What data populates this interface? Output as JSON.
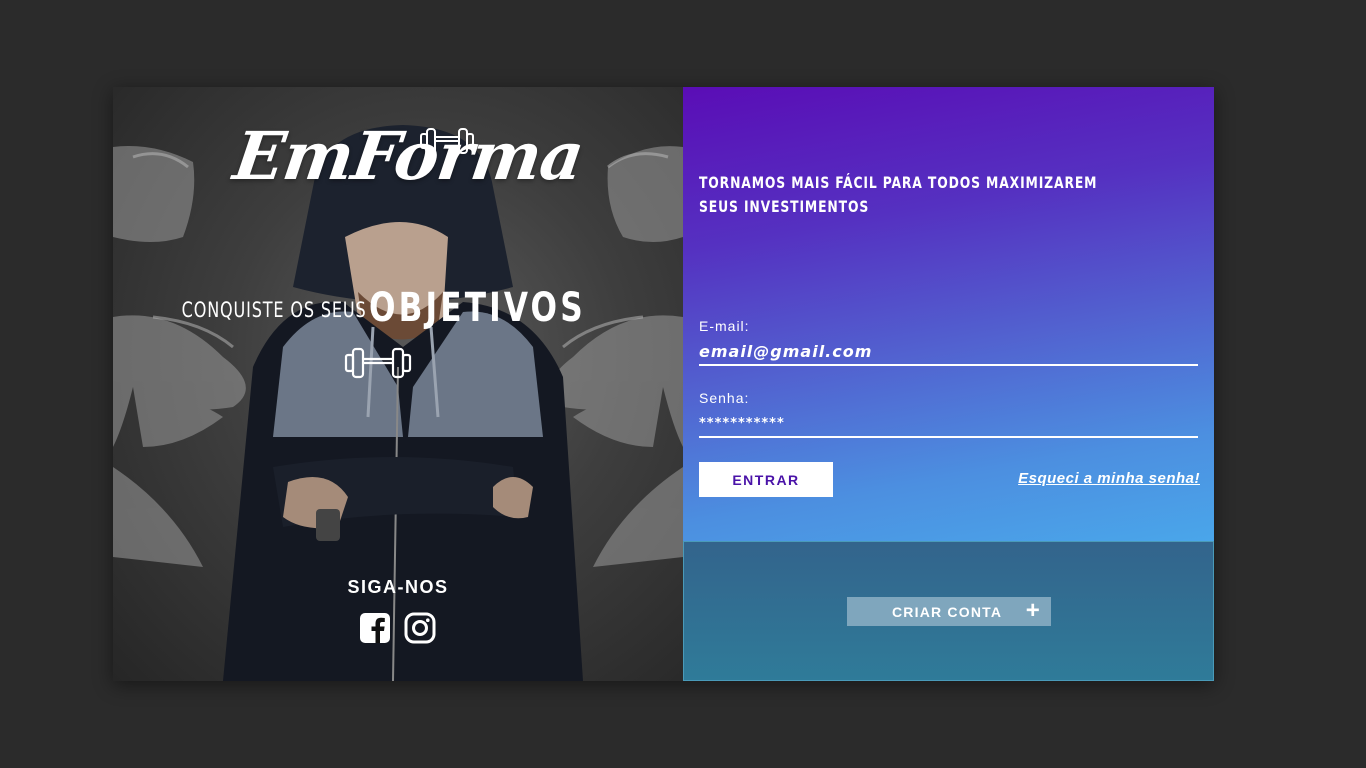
{
  "brand": {
    "logo_text": "EmForma",
    "tagline_small": "CONQUISTE OS SEUS",
    "tagline_big": "OBJETIVOS"
  },
  "social": {
    "title": "SIGA-NOS",
    "icons": [
      "facebook-icon",
      "instagram-icon"
    ]
  },
  "login": {
    "headline_line1": "TORNAMOS MAIS FÁCIL PARA TODOS MAXIMIZAREM",
    "headline_line2": "SEUS INVESTIMENTOS",
    "email_label": "E-mail:",
    "email_value": "email@gmail.com",
    "password_label": "Senha:",
    "password_value": "***********",
    "submit_label": "ENTRAR",
    "forgot_label": "Esqueci a minha senha!"
  },
  "signup": {
    "button_label": "CRIAR CONTA",
    "button_icon": "+"
  },
  "colors": {
    "background": "#2b2b2b",
    "gradient_top": "#5a0db6",
    "gradient_bottom": "#4aa6ea",
    "signup_panel": "#33648c",
    "signup_button": "#7fa6bd",
    "button_text": "#4a13a8"
  }
}
